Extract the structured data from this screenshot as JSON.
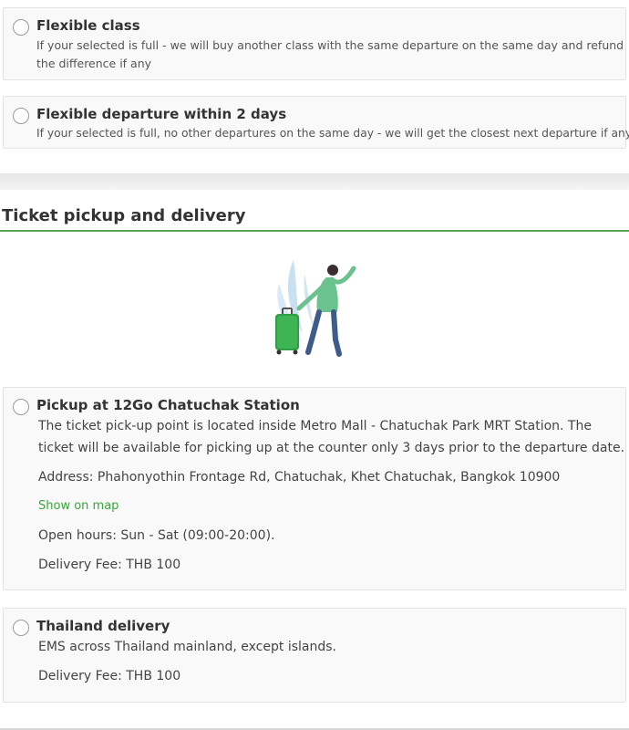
{
  "options": {
    "flexible_class": {
      "title": "Flexible class",
      "desc_line1": "If your selected is full - we will buy another class with the same departure on the same day and refund",
      "desc_line2": "the difference if any"
    },
    "flexible_departure": {
      "title": "Flexible departure within 2 days",
      "desc": "If your selected is full, no other departures on the same day - we will get the closest next departure if any."
    }
  },
  "pickup_section": {
    "title": "Ticket pickup and delivery",
    "pickup_station": {
      "title": "Pickup at 12Go Chatuchak Station",
      "desc_line1": "The ticket pick-up point is located inside Metro Mall - Chatuchak Park MRT Station. The",
      "desc_line2": "ticket will be available for picking up at the counter only 3 days prior to the departure date.",
      "address": "Address: Phahonyothin Frontage Rd, Chatuchak, Khet Chatuchak, Bangkok 10900",
      "map_link": "Show on map",
      "hours": "Open hours: Sun - Sat (09:00-20:00).",
      "fee": "Delivery Fee: THB 100"
    },
    "thailand_delivery": {
      "title": "Thailand delivery",
      "desc": "EMS across Thailand mainland, except islands.",
      "fee": "Delivery Fee: THB 100"
    }
  },
  "colors": {
    "accent_green": "#3ba53b",
    "rule_green": "#5aa55a",
    "card_bg": "#f9f9f9",
    "card_border": "#e3e3e3"
  },
  "illustration_icon": "traveler-with-suitcase-icon"
}
